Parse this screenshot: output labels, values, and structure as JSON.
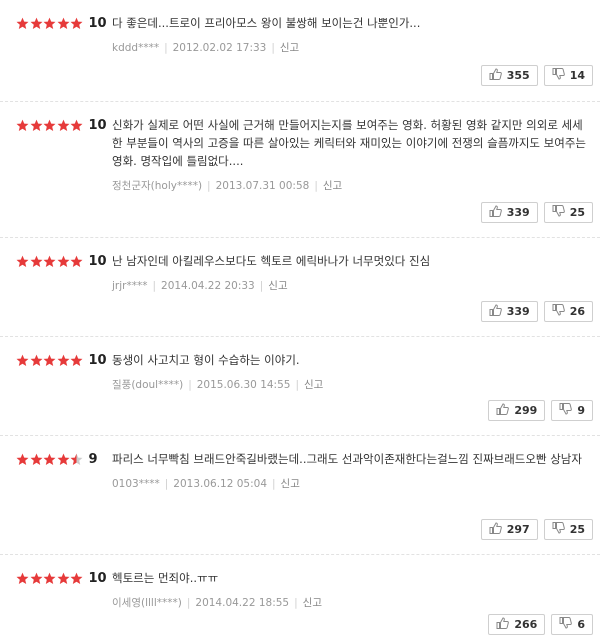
{
  "reviews": [
    {
      "score": "10",
      "stars": [
        1,
        1,
        1,
        1,
        1
      ],
      "text": "다 좋은데...트로이 프리아모스 왕이 불쌍해 보이는건 나뿐인가...",
      "user": "kddd****",
      "date": "2012.02.02 17:33",
      "report": "신고",
      "likes": "355",
      "dislikes": "14"
    },
    {
      "score": "10",
      "stars": [
        1,
        1,
        1,
        1,
        1
      ],
      "text": "신화가 실제로 어떤 사실에 근거해 만들어지는지를 보여주는 영화. 허황된 영화 같지만 의외로 세세한 부분들이 역사의 고증을 따른 살아있는 케릭터와 재미있는 이야기에 전쟁의 슬픔까지도 보여주는 영화. 명작입에 틀림없다....",
      "user": "정천군자(holy****)",
      "date": "2013.07.31 00:58",
      "report": "신고",
      "likes": "339",
      "dislikes": "25"
    },
    {
      "score": "10",
      "stars": [
        1,
        1,
        1,
        1,
        1
      ],
      "text": "난 남자인데 아킬레우스보다도 헥토르 에릭바나가 너무멋있다 진심",
      "user": "jrjr****",
      "date": "2014.04.22 20:33",
      "report": "신고",
      "likes": "339",
      "dislikes": "26"
    },
    {
      "score": "10",
      "stars": [
        1,
        1,
        1,
        1,
        1
      ],
      "text": "동생이 사고치고 형이 수습하는 이야기.",
      "user": "질풍(doul****)",
      "date": "2015.06.30 14:55",
      "report": "신고",
      "likes": "299",
      "dislikes": "9"
    },
    {
      "score": "9",
      "stars": [
        1,
        1,
        1,
        1,
        0.5
      ],
      "text": "파리스 너무빡침 브래드안죽길바랬는데..그래도 선과악이존재한다는걸느낌 진짜브래드오빤 상남자",
      "user": "0103****",
      "date": "2013.06.12 05:04",
      "report": "신고",
      "likes": "297",
      "dislikes": "25"
    },
    {
      "score": "10",
      "stars": [
        1,
        1,
        1,
        1,
        1
      ],
      "text": "헥토르는 먼죄야..ㅠㅠ",
      "user": "이세영(llll****)",
      "date": "2014.04.22 18:55",
      "report": "신고",
      "likes": "266",
      "dislikes": "6"
    }
  ],
  "colors": {
    "star": "#e63a3a",
    "star_empty": "#cccccc"
  },
  "icons": {
    "like": "thumbs-up-icon",
    "dislike": "thumbs-down-icon",
    "star": "star-icon"
  }
}
